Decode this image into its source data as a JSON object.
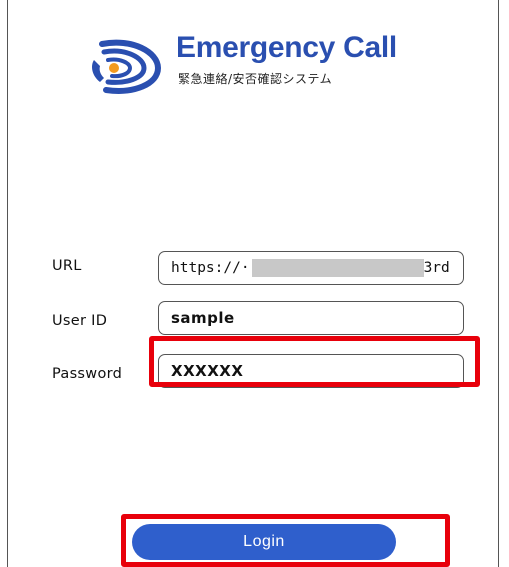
{
  "app": {
    "title": "Emergency Call",
    "subtitle": "緊急連絡/安否確認システム",
    "logo_icon": "phone-signal-icon",
    "brand_color": "#2a4fb0"
  },
  "form": {
    "url": {
      "label": "URL",
      "value_prefix": "https://·",
      "value_suffix": "3rd"
    },
    "user_id": {
      "label": "User ID",
      "value": "sample"
    },
    "password": {
      "label": "Password",
      "value": "XXXXXX"
    }
  },
  "login": {
    "label": "Login",
    "color": "#2f5fcc"
  },
  "annotations": {
    "highlight_color": "#e8000b"
  }
}
